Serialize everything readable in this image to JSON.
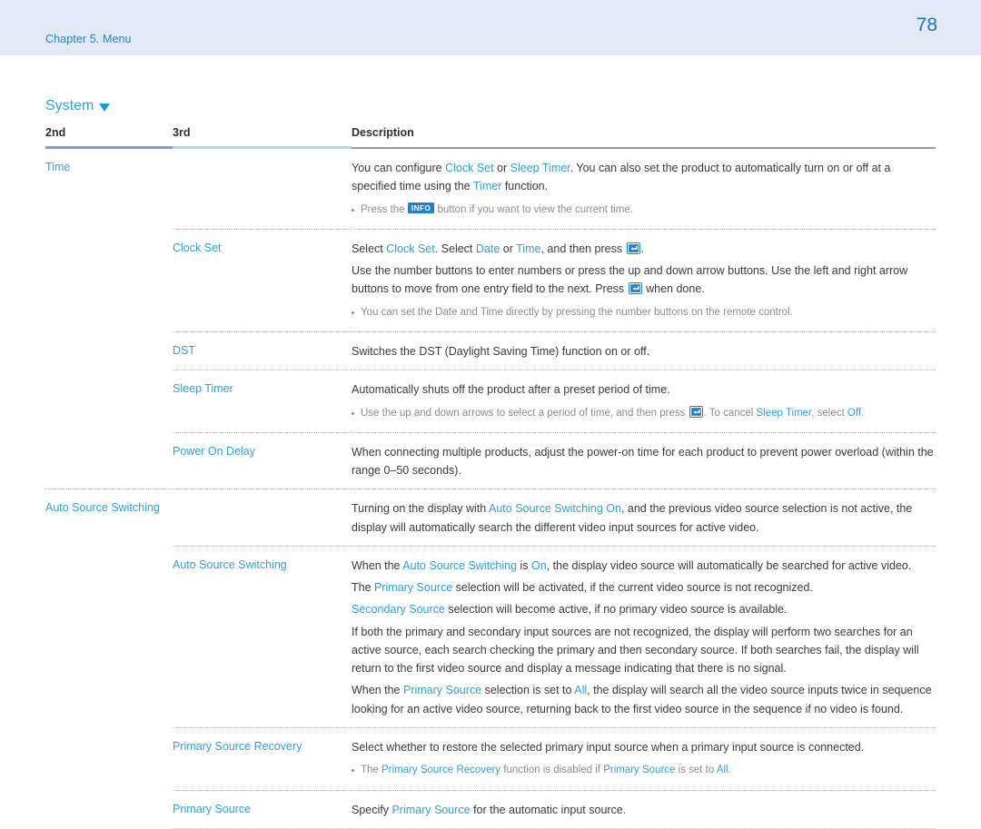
{
  "header": {
    "chapter": "Chapter 5. Menu",
    "page_number": "78",
    "band_color": "#e3e8f5",
    "chapter_color": "#2f7fc4",
    "page_number_color": "#1f76c0"
  },
  "section": {
    "title": "System",
    "caret_icon": "triangle-down-icon",
    "accent_color": "#2f9fe0"
  },
  "table": {
    "columns": [
      "2nd",
      "3rd",
      "Description"
    ],
    "rule_colors": [
      "#7fa0cf",
      "#a8dbef",
      "#9a9a9a"
    ],
    "rows": [
      {
        "id": "time",
        "second": "Time",
        "third": "",
        "paragraphs": [
          "You can configure |Clock Set| or |Sleep Timer|. You can also set the product to automatically turn on or off at a specified time using the |Timer| function."
        ],
        "notes": [
          "Press the [INFO] button if you want to view the current time."
        ]
      },
      {
        "id": "clock-set",
        "second": "",
        "third": "Clock Set",
        "paragraphs": [
          "Select |Clock Set|. Select |Date| or |Time|, and then press [ENTER].",
          "Use the number buttons to enter numbers or press the up and down arrow buttons. Use the left and right arrow buttons to move from one entry field to the next. Press [ENTER] when done."
        ],
        "notes": [
          "You can set the Date and Time directly by pressing the number buttons on the remote control."
        ]
      },
      {
        "id": "dst",
        "second": "",
        "third": "DST",
        "paragraphs": [
          "Switches the DST (Daylight Saving Time) function on or off."
        ],
        "notes": []
      },
      {
        "id": "sleep-timer",
        "second": "",
        "third": "Sleep Timer",
        "paragraphs": [
          "Automatically shuts off the product after a preset period of time."
        ],
        "notes": [
          "Use the up and down arrows to select a period of time, and then press [ENTER]. To cancel |Sleep Timer|, select |Off|."
        ]
      },
      {
        "id": "power-on-delay",
        "second": "",
        "third": "Power On Delay",
        "paragraphs": [
          "When connecting multiple products, adjust the power-on time for each product to prevent power overload (within the range 0–50 seconds)."
        ],
        "notes": []
      },
      {
        "id": "auto-source-switching-group",
        "second": "Auto Source Switching",
        "third": "",
        "new_group": true,
        "paragraphs": [
          "Turning on the display with |Auto Source Switching On|, and the previous video source selection is not active, the display will automatically search the different video input sources for active video."
        ],
        "notes": []
      },
      {
        "id": "auto-source-switching",
        "second": "",
        "third": "Auto Source Switching",
        "paragraphs": [
          "When the |Auto Source Switching| is |On|, the display video source will automatically be searched for active video.",
          "The |Primary Source| selection will be activated, if the current video source is not recognized.",
          "|Secondary Source| selection will become active, if no primary video source is available.",
          "If both the primary and secondary input sources are not recognized, the display will perform two searches for an active source, each search checking the primary and then secondary source. If both searches fail, the display will return to the first video source and display a message indicating that there is no signal.",
          "When the |Primary Source| selection is set to |All|, the display will search all the video source inputs twice in sequence looking for an active video source, returning back to the first video source in the sequence if no video is found."
        ],
        "notes": []
      },
      {
        "id": "primary-source-recovery",
        "second": "",
        "third": "Primary Source Recovery",
        "paragraphs": [
          "Select whether to restore the selected primary input source when a primary input source is connected."
        ],
        "notes": [
          "The |Primary Source Recovery| function is disabled if |Primary Source| is set to |All|."
        ]
      },
      {
        "id": "primary-source",
        "second": "",
        "third": "Primary Source",
        "paragraphs": [
          "Specify |Primary Source| for the automatic input source."
        ],
        "notes": []
      }
    ]
  },
  "keys": {
    "info_label": "INFO",
    "enter_icon": "enter-key-icon",
    "key_color": "#1f7fd0"
  }
}
